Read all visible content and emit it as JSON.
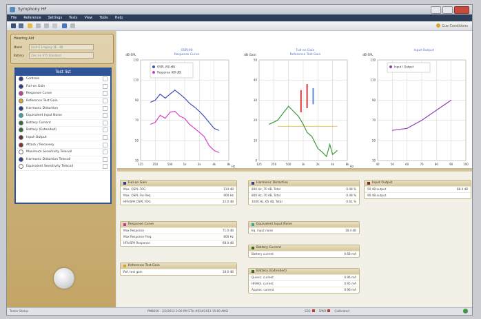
{
  "window": {
    "title": "Symphony HF"
  },
  "menu": [
    "File",
    "Reference",
    "Settings",
    "Tests",
    "View",
    "Tools",
    "Help"
  ],
  "toolbar": {
    "right_label": "Cue Conditions"
  },
  "hearing_aid": {
    "title": "Hearing Aid",
    "model_label": "Model",
    "model_value": "2cc6 E 1mgnny 3E.. 48",
    "battery_label": "Battery",
    "battery_value": "Zinc Air 675 Standard"
  },
  "test_list": {
    "title": "Test list",
    "items": [
      {
        "label": "Controls",
        "color": "#2b3f8c"
      },
      {
        "label": "Full-on Gain",
        "color": "#2b3f8c"
      },
      {
        "label": "Response Curve",
        "color": "#c93c9a"
      },
      {
        "label": "Reference Test Gain",
        "color": "#d9a630"
      },
      {
        "label": "Harmonic Distortion",
        "color": "#2b3f8c"
      },
      {
        "label": "Equivalent Input Noise",
        "color": "#3aa6a6"
      },
      {
        "label": "Battery Current",
        "color": "#2f6b2f"
      },
      {
        "label": "Battery (Extended)",
        "color": "#2f6b2f"
      },
      {
        "label": "Input-Output",
        "color": "#6b2f2f"
      },
      {
        "label": "Attack / Recovery",
        "color": "#8c2b2b"
      },
      {
        "label": "Maximum Sensitivity Telecoil",
        "color": "#ffffff"
      },
      {
        "label": "Harmonic Distortion Telecoil",
        "color": "#2b3f8c"
      },
      {
        "label": "Equivalent Sensitivity Telecoil",
        "color": "#ffffff"
      }
    ]
  },
  "charts": {
    "response": {
      "title": "OSPL90",
      "subtitle": "Response Curve",
      "ylabel": "dB SPL",
      "xunit": "Hz",
      "yticks": [
        "130",
        "110",
        "90",
        "70",
        "50",
        "30"
      ],
      "xticks": [
        "125",
        "250",
        "500",
        "1k",
        "2k",
        "4k",
        "8k"
      ],
      "legend": [
        "OSPL (90 dB)",
        "Response (60 dB)"
      ],
      "colors": [
        "#3a4fb5",
        "#d43fc4"
      ]
    },
    "gain": {
      "title": "Full-on Gain",
      "subtitle": "Reference Test Gain",
      "ylabel": "dB Gain",
      "xunit": "Hz",
      "yticks": [
        "50",
        "40",
        "30",
        "20",
        "10",
        "0"
      ],
      "xticks": [
        "125",
        "250",
        "500",
        "1k",
        "2k",
        "4k",
        "8k"
      ],
      "colors": [
        "#3d9a3d",
        "#d43a3a",
        "#5b8ad8",
        "#e9b840"
      ]
    },
    "io": {
      "title": "Input-Output",
      "ylabel": "dB SPL",
      "yticks": [
        "130",
        "110",
        "90",
        "70",
        "50",
        "30"
      ],
      "xticks": [
        "40",
        "50",
        "60",
        "70",
        "80",
        "90",
        "100"
      ],
      "legend": [
        "Input / Output"
      ],
      "colors": [
        "#8e3fb0"
      ]
    }
  },
  "chart_data": [
    {
      "type": "line",
      "title": "OSPL90",
      "ylabel": "dB SPL",
      "x": [
        200,
        250,
        315,
        400,
        500,
        630,
        800,
        1000,
        1250,
        1600,
        2000,
        2500,
        3150,
        4000,
        5000
      ],
      "series": [
        {
          "name": "OSPL (90 dB)",
          "values": [
            88,
            90,
            96,
            92,
            96,
            100,
            96,
            92,
            87,
            83,
            79,
            74,
            68,
            62,
            60
          ]
        },
        {
          "name": "Response (60 dB)",
          "values": [
            66,
            68,
            75,
            72,
            78,
            79,
            74,
            72,
            66,
            62,
            58,
            54,
            45,
            40,
            38
          ]
        }
      ],
      "ylim": [
        30,
        130
      ]
    },
    {
      "type": "line",
      "title": "Full-on Gain",
      "ylabel": "dB Gain",
      "x": [
        200,
        300,
        400,
        500,
        600,
        800,
        1000,
        1200,
        1500,
        2000,
        2500,
        3000,
        3500,
        4000,
        5000
      ],
      "series": [
        {
          "name": "",
          "values": [
            18,
            20,
            24,
            27,
            25,
            22,
            18,
            14,
            12,
            6,
            4,
            2,
            8,
            3,
            5
          ]
        }
      ],
      "ylim": [
        0,
        50
      ]
    },
    {
      "type": "line",
      "title": "Input-Output",
      "ylabel": "dB SPL",
      "x": [
        50,
        60,
        70,
        80,
        90
      ],
      "series": [
        {
          "name": "Input / Output",
          "values": [
            60,
            62,
            70,
            80,
            90
          ]
        }
      ],
      "ylim": [
        30,
        130
      ]
    }
  ],
  "cards": {
    "full_on_gain": {
      "title": "Full-on Gain",
      "rows": [
        [
          "Max. OSPL FOG",
          "114 dB"
        ],
        [
          "Max. OSPL Fre Req.",
          "900 Hz"
        ],
        [
          "HFA/SPA OSPL FOG",
          "22.0 dB"
        ]
      ]
    },
    "response_curve": {
      "title": "Response Curve",
      "rows": [
        [
          "Max Response",
          "71.0 dB"
        ],
        [
          "Max Response Freq.",
          "800 Hz"
        ],
        [
          "HFA/SPA Response",
          "68.0 dB"
        ]
      ]
    },
    "reference_gain": {
      "title": "Reference Test Gain",
      "rows": [
        [
          "Ref. test gain",
          "18.0 dB"
        ]
      ]
    },
    "harmonic_distortion": {
      "title": "Harmonic Distortion",
      "rows": [
        [
          "800 Hz, 70 dB, Total",
          "0.48 %"
        ],
        [
          "800 Hz, 70 dB, Total",
          "0.48 %"
        ],
        [
          "1600 Hz, 65 dB, Total",
          "0.61 %"
        ]
      ]
    },
    "equivalent_noise": {
      "title": "Equivalent Input Noise",
      "rows": [
        [
          "Eq. input noise",
          "18.4 dB"
        ]
      ]
    },
    "battery_current": {
      "title": "Battery Current",
      "rows": [
        [
          "Battery current",
          "0.68 mA"
        ]
      ]
    },
    "battery_extended": {
      "title": "Battery (Extended)",
      "rows": [
        [
          "Quiesc. current",
          "0.96 mA"
        ],
        [
          "HFAVol. current",
          "0.95 mA"
        ],
        [
          "Approx. current",
          "0.96 mA"
        ]
      ]
    },
    "input_output": {
      "title": "Input Output",
      "rows": [
        [
          "50 dB output",
          "68.4 dB"
        ],
        [
          "90 dB output",
          ""
        ]
      ]
    }
  },
  "status": {
    "left": "Tester Status",
    "middle": "PM8020 - 3/3/2012 2:00 PM  STH #054/2013 15:00 ANSI",
    "right_1": "SEQ",
    "right_2": "SPKR",
    "right_3": "Calibrated"
  }
}
